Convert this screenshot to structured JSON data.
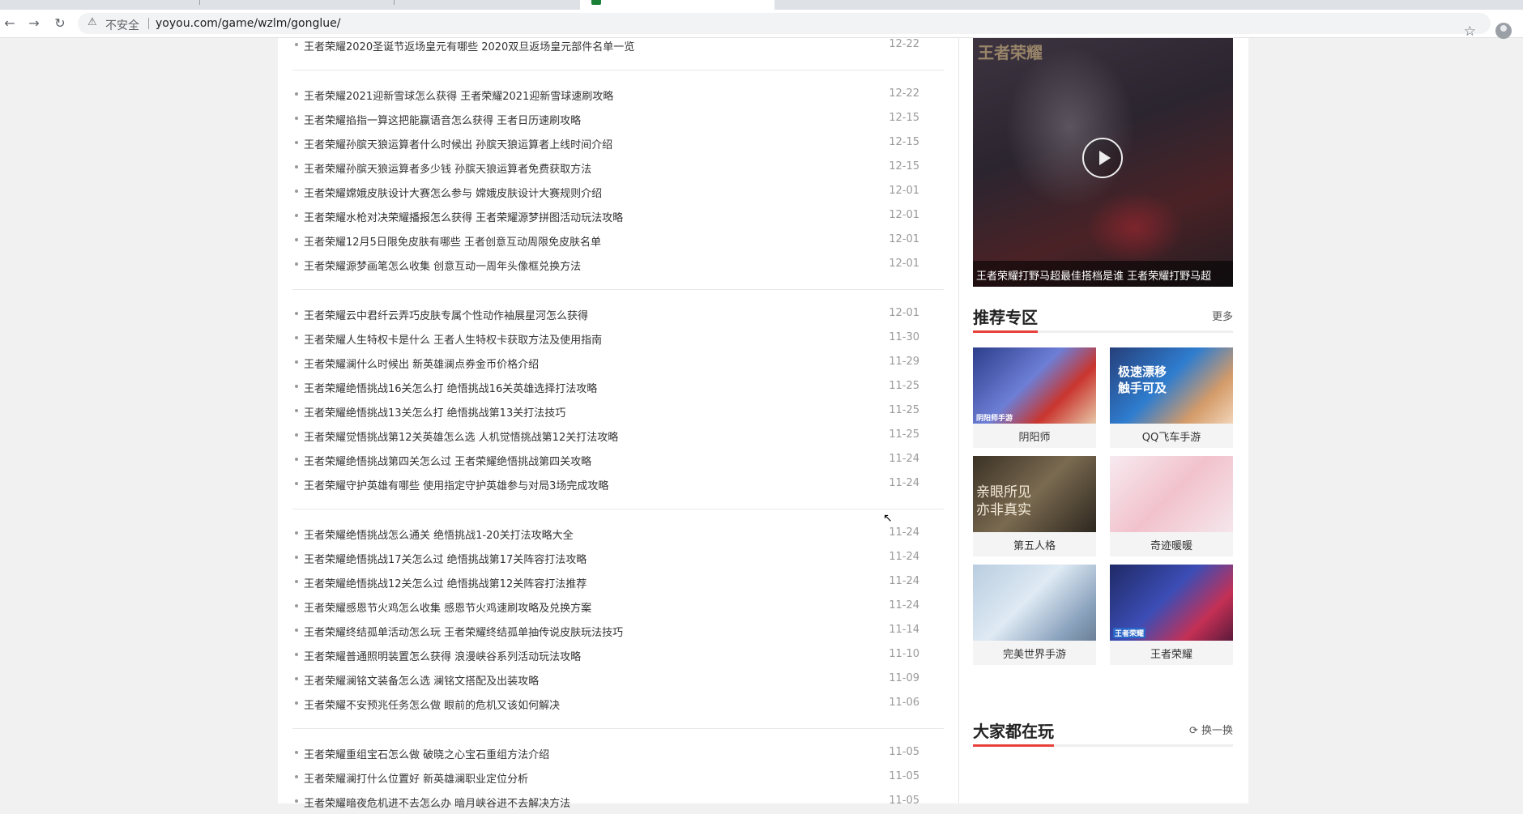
{
  "browser": {
    "insecure_label": "不安全",
    "url": "yoyou.com/game/wzlm/gonglue/"
  },
  "article_groups": [
    {
      "items": [
        {
          "title": "王者荣耀2020圣诞节返场皇元有哪些 2020双旦返场皇元部件名单一览",
          "date": "12-22"
        }
      ]
    },
    {
      "items": [
        {
          "title": "王者荣耀2021迎新雪球怎么获得 王者荣耀2021迎新雪球速刷攻略",
          "date": "12-22"
        },
        {
          "title": "王者荣耀掐指一算这把能赢语音怎么获得 王者日历速刷攻略",
          "date": "12-15"
        },
        {
          "title": "王者荣耀孙膑天狼运算者什么时候出 孙膑天狼运算者上线时间介绍",
          "date": "12-15"
        },
        {
          "title": "王者荣耀孙膑天狼运算者多少钱 孙膑天狼运算者免费获取方法",
          "date": "12-15"
        },
        {
          "title": "王者荣耀嫦娥皮肤设计大赛怎么参与 嫦娥皮肤设计大赛规则介绍",
          "date": "12-01"
        },
        {
          "title": "王者荣耀水枪对决荣耀播报怎么获得 王者荣耀源梦拼图活动玩法攻略",
          "date": "12-01"
        },
        {
          "title": "王者荣耀12月5日限免皮肤有哪些 王者创意互动周限免皮肤名单",
          "date": "12-01"
        },
        {
          "title": "王者荣耀源梦画笔怎么收集 创意互动一周年头像框兑换方法",
          "date": "12-01"
        }
      ]
    },
    {
      "items": [
        {
          "title": "王者荣耀云中君纤云弄巧皮肤专属个性动作袖展星河怎么获得",
          "date": "12-01"
        },
        {
          "title": "王者荣耀人生特权卡是什么 王者人生特权卡获取方法及使用指南",
          "date": "11-30"
        },
        {
          "title": "王者荣耀澜什么时候出 新英雄澜点券金币价格介绍",
          "date": "11-29"
        },
        {
          "title": "王者荣耀绝悟挑战16关怎么打 绝悟挑战16关英雄选择打法攻略",
          "date": "11-25"
        },
        {
          "title": "王者荣耀绝悟挑战13关怎么打 绝悟挑战第13关打法技巧",
          "date": "11-25"
        },
        {
          "title": "王者荣耀觉悟挑战第12关英雄怎么选 人机觉悟挑战第12关打法攻略",
          "date": "11-25"
        },
        {
          "title": "王者荣耀绝悟挑战第四关怎么过 王者荣耀绝悟挑战第四关攻略",
          "date": "11-24"
        },
        {
          "title": "王者荣耀守护英雄有哪些 使用指定守护英雄参与对局3场完成攻略",
          "date": "11-24"
        }
      ]
    },
    {
      "items": [
        {
          "title": "王者荣耀绝悟挑战怎么通关 绝悟挑战1-20关打法攻略大全",
          "date": "11-24"
        },
        {
          "title": "王者荣耀绝悟挑战17关怎么过 绝悟挑战第17关阵容打法攻略",
          "date": "11-24"
        },
        {
          "title": "王者荣耀绝悟挑战12关怎么过 绝悟挑战第12关阵容打法推荐",
          "date": "11-24"
        },
        {
          "title": "王者荣耀感恩节火鸡怎么收集 感恩节火鸡速刷攻略及兑换方案",
          "date": "11-24"
        },
        {
          "title": "王者荣耀终结孤单活动怎么玩 王者荣耀终结孤单抽传说皮肤玩法技巧",
          "date": "11-14"
        },
        {
          "title": "王者荣耀普通照明装置怎么获得 浪漫峡谷系列活动玩法攻略",
          "date": "11-10"
        },
        {
          "title": "王者荣耀澜铭文装备怎么选 澜铭文搭配及出装攻略",
          "date": "11-09"
        },
        {
          "title": "王者荣耀不安预兆任务怎么做 眼前的危机又该如何解决",
          "date": "11-06"
        }
      ]
    },
    {
      "items": [
        {
          "title": "王者荣耀重组宝石怎么做 破晓之心宝石重组方法介绍",
          "date": "11-05"
        },
        {
          "title": "王者荣耀澜打什么位置好 新英雄澜职业定位分析",
          "date": "11-05"
        },
        {
          "title": "王者荣耀暗夜危机进不去怎么办 暗月峡谷进不去解决方法",
          "date": "11-05"
        }
      ]
    }
  ],
  "sidebar": {
    "video": {
      "logo_text": "王者荣耀",
      "caption": "王者荣耀打野马超最佳搭档是谁 王者荣耀打野马超"
    },
    "recommend": {
      "heading": "推荐专区",
      "more": "更多",
      "zones": [
        {
          "name": "阴阳师",
          "thumb_text": "阴阳师手游"
        },
        {
          "name": "QQ飞车手游",
          "thumb_text": "极速漂移 触手可及"
        },
        {
          "name": "第五人格",
          "thumb_text": "亲眼所见 亦非真实"
        },
        {
          "name": "奇迹暖暖",
          "thumb_text": ""
        },
        {
          "name": "完美世界手游",
          "thumb_text": ""
        },
        {
          "name": "王者荣耀",
          "thumb_text": "王者荣耀"
        }
      ]
    },
    "playing": {
      "heading": "大家都在玩",
      "refresh": "换一换"
    }
  }
}
